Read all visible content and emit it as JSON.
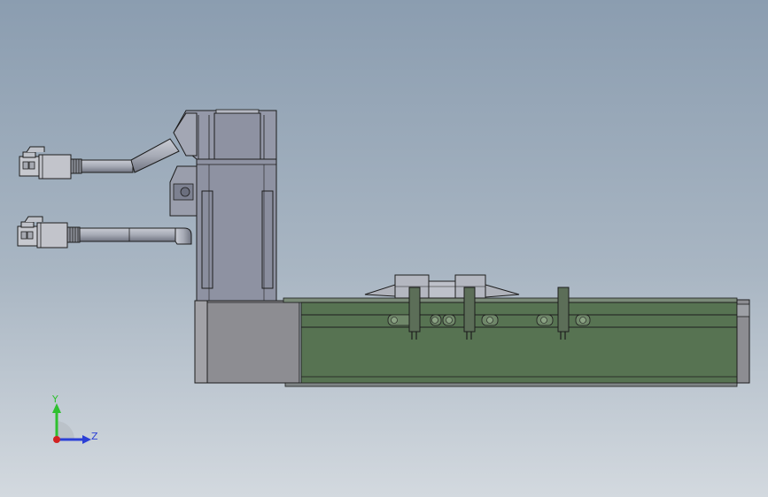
{
  "viewport": {
    "triad": {
      "y_label": "Y",
      "z_label": "Z",
      "y_color": "#2fc02f",
      "z_color": "#2b3fd6",
      "origin_color": "#d22222"
    }
  },
  "colors": {
    "motor_body": "#8e92a2",
    "carriage_green": "#577352",
    "housing_gray": "#8d8d92",
    "outline": "#1d1d1d",
    "cable": "#a7abb6"
  },
  "parts": [
    {
      "name": "servo-motor"
    },
    {
      "name": "motor-end-housing"
    },
    {
      "name": "linear-actuator-body"
    },
    {
      "name": "carriage-block"
    },
    {
      "name": "power-cable-with-connector"
    },
    {
      "name": "encoder-cable-with-connector"
    }
  ]
}
